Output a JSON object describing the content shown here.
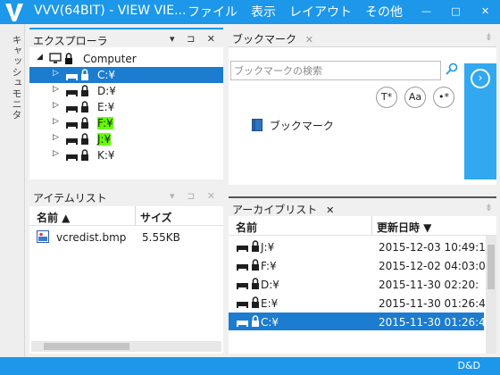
{
  "titlebar": {
    "title": "VVV(64BIT) - VIEW VIE...",
    "menu": [
      "ファイル",
      "表示",
      "レイアウト",
      "その他"
    ],
    "controls": [
      "—",
      "□",
      "✕"
    ]
  },
  "vstrip": {
    "label": "キャッシュモニタ"
  },
  "explorer": {
    "title": "エクスプローラ",
    "controls": "▾ ⊐ ✕",
    "root": "Computer",
    "drives": [
      {
        "label": "C:¥",
        "selected": true,
        "highlight": false
      },
      {
        "label": "D:¥",
        "selected": false,
        "highlight": false
      },
      {
        "label": "E:¥",
        "selected": false,
        "highlight": false
      },
      {
        "label": "F:¥",
        "selected": false,
        "highlight": true
      },
      {
        "label": "J:¥",
        "selected": false,
        "highlight": true
      },
      {
        "label": "K:¥",
        "selected": false,
        "highlight": false
      }
    ]
  },
  "items": {
    "title": "アイテムリスト",
    "controls": "▾ ⊐ ✕",
    "columns": [
      "名前 ▲",
      "サイズ"
    ],
    "rows": [
      {
        "name": "vcredist.bmp",
        "size": "5.55KB"
      }
    ]
  },
  "bookmark": {
    "tab": "ブックマーク",
    "tab_close": "✕",
    "search_placeholder": "ブックマークの検索",
    "buttons": [
      "T*",
      "Aa",
      "•*"
    ],
    "item": "ブックマーク"
  },
  "archive": {
    "tab": "アーカイブリスト",
    "tab_close": "✕",
    "columns": [
      "名前",
      "更新日時 ▼"
    ],
    "rows": [
      {
        "name": "J:¥",
        "date": "2015-12-03 10:49:1",
        "selected": false
      },
      {
        "name": "F:¥",
        "date": "2015-12-02 04:03:0",
        "selected": false
      },
      {
        "name": "D:¥",
        "date": "2015-11-30 02:20:",
        "selected": false
      },
      {
        "name": "E:¥",
        "date": "2015-11-30 01:26:4",
        "selected": false
      },
      {
        "name": "C:¥",
        "date": "2015-11-30 01:26:4",
        "selected": true
      }
    ]
  },
  "statusbar": {
    "text": "D&D"
  },
  "colors": {
    "accent": "#1c97ea",
    "selection": "#1c7ccf",
    "highlight": "#66ff00",
    "side_button": "#31a8f0"
  }
}
